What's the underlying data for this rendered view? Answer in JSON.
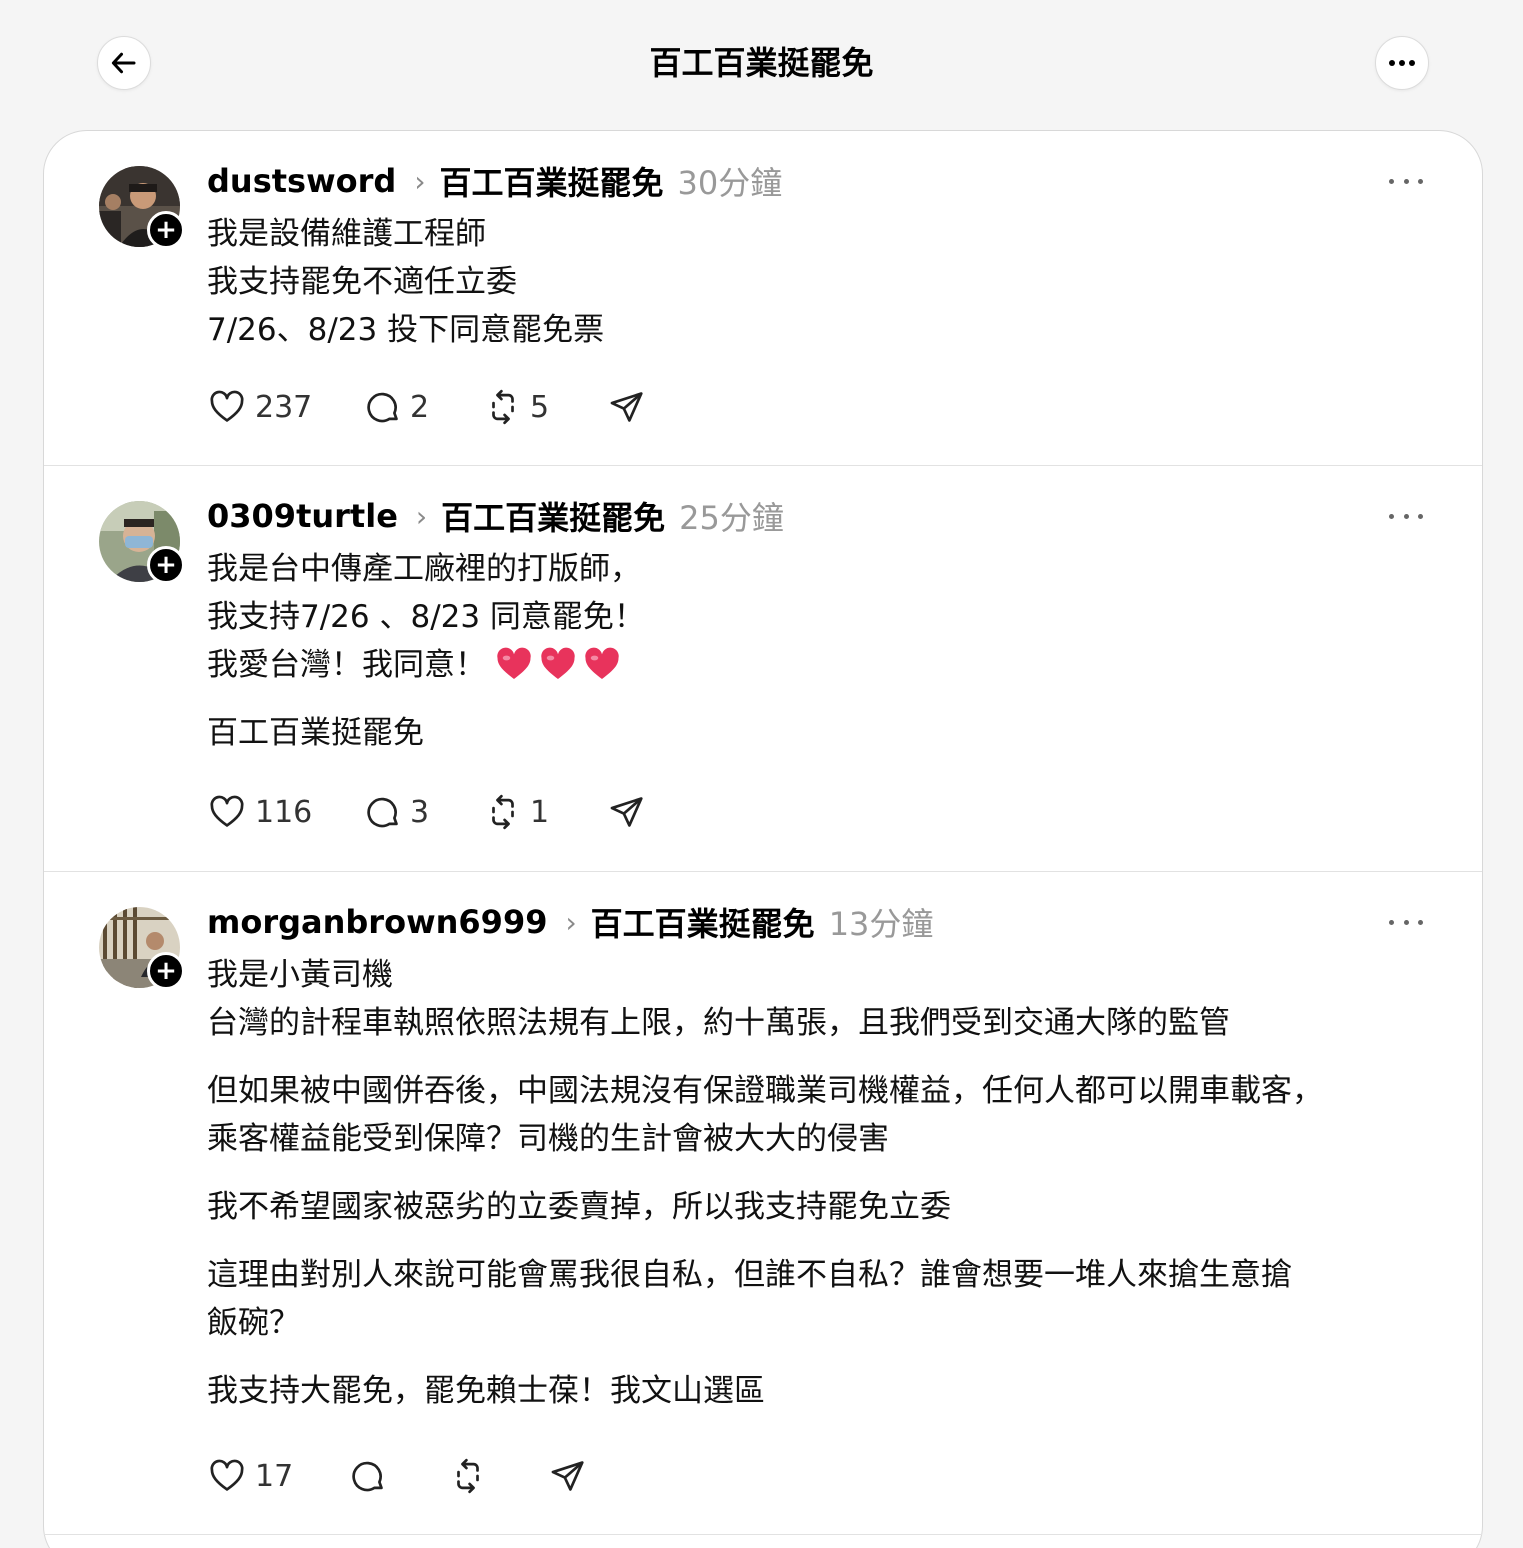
{
  "header": {
    "title": "百工百業挺罷免"
  },
  "posts": [
    {
      "username": "dustsword",
      "community": "百工百業挺罷免",
      "time": "30分鐘",
      "lines": [
        "我是設備維護工程師",
        "我支持罷免不適任立委",
        "7/26、8/23 投下同意罷免票"
      ],
      "likes": "237",
      "comments": "2",
      "reposts": "5"
    },
    {
      "username": "0309turtle",
      "community": "百工百業挺罷免",
      "time": "25分鐘",
      "lines": [
        "我是台中傳產工廠裡的打版師，",
        "我支持7/26 、8/23 同意罷免！",
        "我愛台灣！我同意！"
      ],
      "extra": "百工百業挺罷免",
      "likes": "116",
      "comments": "3",
      "reposts": "1"
    },
    {
      "username": "morganbrown6999",
      "community": "百工百業挺罷免",
      "time": "13分鐘",
      "para1": [
        "我是小黃司機",
        "台灣的計程車執照依照法規有上限，約十萬張，且我們受到交通大隊的監管"
      ],
      "para2": [
        "但如果被中國併吞後，中國法規沒有保證職業司機權益，任何人都可以開車載客，",
        "乘客權益能受到保障？司機的生計會被大大的侵害"
      ],
      "para3": [
        "我不希望國家被惡劣的立委賣掉，所以我支持罷免立委"
      ],
      "para4": [
        "這理由對別人來說可能會罵我很自私，但誰不自私？誰會想要一堆人來搶生意搶",
        "飯碗？"
      ],
      "para5": [
        "我支持大罷免，罷免賴士葆！我文山選區"
      ],
      "likes": "17"
    }
  ],
  "icons": {
    "back": "arrow-left-icon",
    "more": "more-horizontal-icon",
    "like": "heart-icon",
    "comment": "comment-bubble-icon",
    "repost": "repost-icon",
    "share": "send-icon",
    "emoji": "heart-emoji-icon"
  },
  "colors": {
    "accent": "#000000",
    "emoji_heart": "#e8335c",
    "muted": "#999999"
  }
}
